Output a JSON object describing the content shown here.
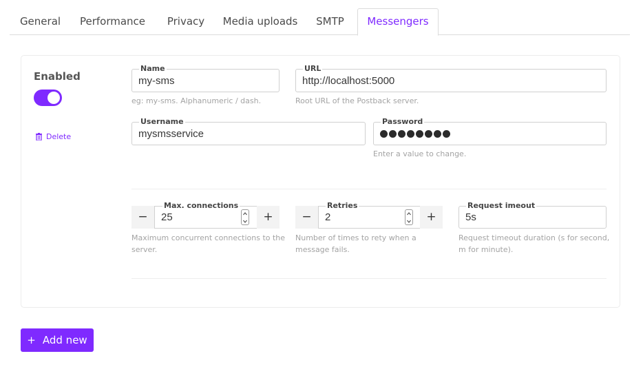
{
  "tabs": [
    {
      "label": "General"
    },
    {
      "label": "Performance"
    },
    {
      "label": "Privacy"
    },
    {
      "label": "Media uploads"
    },
    {
      "label": "SMTP"
    },
    {
      "label": "Messengers"
    }
  ],
  "active_tab": "Messengers",
  "messenger": {
    "enabled_label": "Enabled",
    "enabled": true,
    "delete_label": "Delete",
    "name": {
      "label": "Name",
      "value": "my-sms",
      "help": "eg: my-sms. Alphanumeric / dash."
    },
    "url": {
      "label": "URL",
      "value": "http://localhost:5000",
      "help": "Root URL of the Postback server."
    },
    "username": {
      "label": "Username",
      "value": "mysmsservice"
    },
    "password": {
      "label": "Password",
      "masked_chars": 8,
      "help": "Enter a value to change."
    },
    "max_connections": {
      "label": "Max. connections",
      "value": "25",
      "help_line1": "Maximum concurrent connections to the",
      "help_line2": "server."
    },
    "retries": {
      "label": "Retries",
      "value": "2",
      "help_line1": "Number of times to rety when a",
      "help_line2": "message fails."
    },
    "timeout": {
      "label": "Request imeout",
      "value": "5s",
      "help_line1": "Request timeout duration (s for second,",
      "help_line2": "m for minute)."
    }
  },
  "stepper": {
    "minus": "−",
    "plus": "+"
  },
  "add_button": {
    "icon": "+",
    "label": "Add new"
  },
  "colors": {
    "accent": "#7f2aff",
    "border": "#d0d0d0",
    "help_text": "#a3a3a3"
  }
}
